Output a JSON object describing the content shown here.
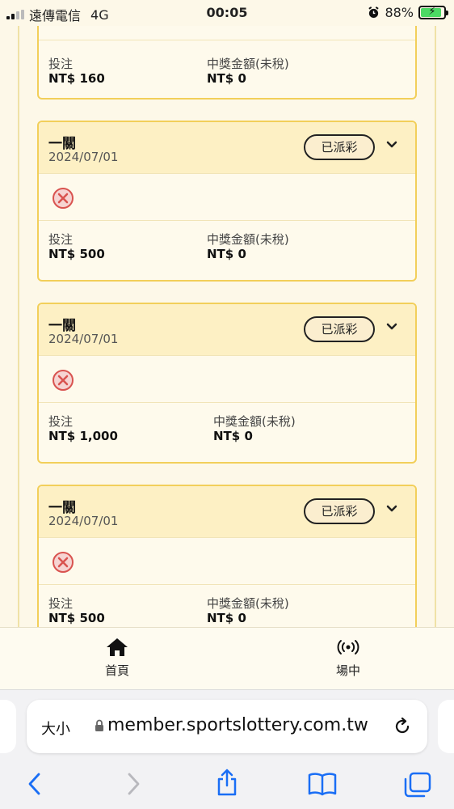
{
  "status_bar": {
    "carrier": "遠傳電信",
    "network": "4G",
    "time": "00:05",
    "battery": "88%"
  },
  "cards": [
    {
      "bet_label": "投注",
      "bet_value": "NT$ 160",
      "prize_label": "中獎金額(未稅)",
      "prize_value": "NT$ 0"
    },
    {
      "title": "一關",
      "date": "2024/07/01",
      "status": "已派彩",
      "bet_label": "投注",
      "bet_value": "NT$ 500",
      "prize_label": "中獎金額(未稅)",
      "prize_value": "NT$ 0"
    },
    {
      "title": "一關",
      "date": "2024/07/01",
      "status": "已派彩",
      "bet_label": "投注",
      "bet_value": "NT$ 1,000",
      "prize_label": "中獎金額(未稅)",
      "prize_value": "NT$ 0"
    },
    {
      "title": "一關",
      "date": "2024/07/01",
      "status": "已派彩",
      "bet_label": "投注",
      "bet_value": "NT$ 500",
      "prize_label": "中獎金額(未稅)",
      "prize_value": "NT$ 0"
    }
  ],
  "bottom_nav": {
    "home": "首頁",
    "live": "場中"
  },
  "browser": {
    "text_size": "大小",
    "url": "member.sportslottery.com.tw"
  },
  "icons": {
    "result": "cross-circle-icon",
    "expand": "chevron-down-icon",
    "home": "home-icon",
    "live": "broadcast-icon"
  },
  "colors": {
    "card_border": "#f2cf5a",
    "card_header": "#fdf0c4",
    "lose_icon": "#d9534f"
  }
}
